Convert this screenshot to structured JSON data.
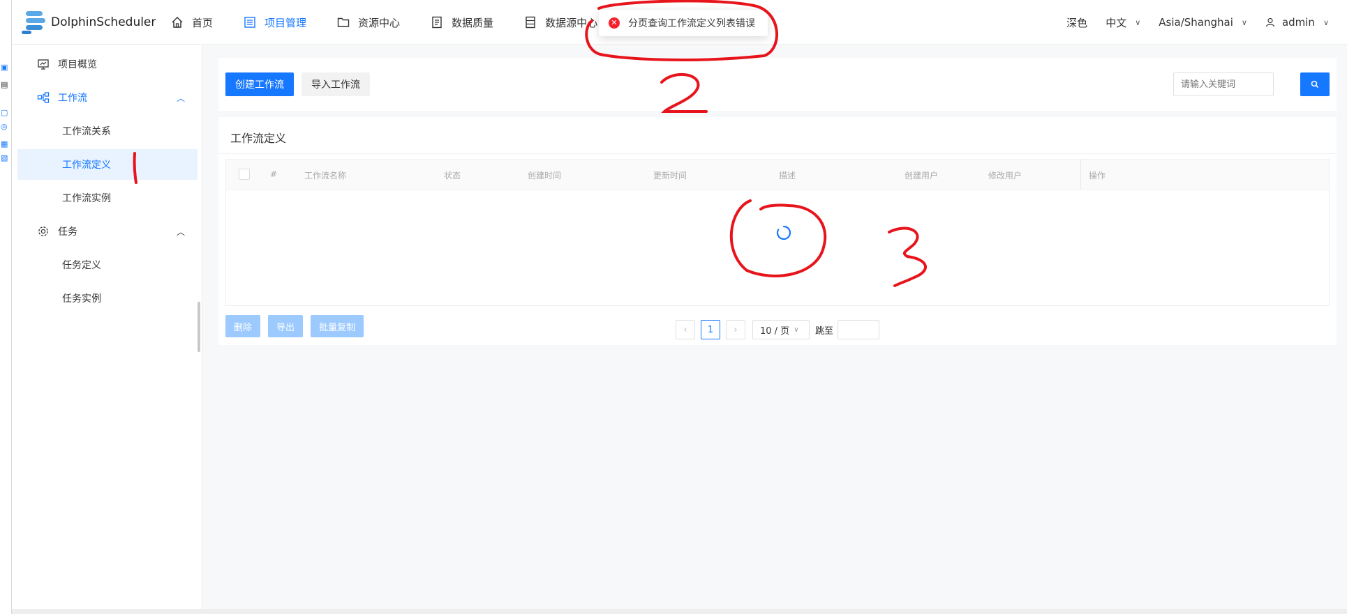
{
  "header": {
    "logo_text": "DolphinScheduler",
    "nav": [
      {
        "label": "首页",
        "icon": "home-icon"
      },
      {
        "label": "项目管理",
        "icon": "project-icon"
      },
      {
        "label": "资源中心",
        "icon": "folder-icon"
      },
      {
        "label": "数据质量",
        "icon": "data-quality-icon"
      },
      {
        "label": "数据源中心",
        "icon": "datasource-icon"
      }
    ],
    "active_nav": "项目管理",
    "theme_label": "深色",
    "language": "中文",
    "timezone": "Asia/Shanghai",
    "user": "admin"
  },
  "toast": {
    "message": "分页查询工作流定义列表错误",
    "type": "error"
  },
  "sidebar": {
    "items": [
      {
        "label": "项目概览",
        "icon": "overview-icon"
      },
      {
        "label": "工作流",
        "icon": "workflow-icon",
        "expanded": true
      },
      {
        "label": "工作流关系"
      },
      {
        "label": "工作流定义",
        "active": true
      },
      {
        "label": "工作流实例"
      },
      {
        "label": "任务",
        "icon": "task-gear-icon",
        "expanded": true
      },
      {
        "label": "任务定义"
      },
      {
        "label": "任务实例"
      }
    ]
  },
  "toolbar": {
    "create_label": "创建工作流",
    "import_label": "导入工作流",
    "search_placeholder": "请输入关键词"
  },
  "list": {
    "title": "工作流定义",
    "columns": [
      "#",
      "工作流名称",
      "状态",
      "创建时间",
      "更新时间",
      "描述",
      "创建用户",
      "修改用户",
      "操作"
    ],
    "loading": true
  },
  "actions": {
    "delete_label": "删除",
    "export_label": "导出",
    "batch_copy_label": "批量复制"
  },
  "pagination": {
    "current_page": "1",
    "page_size": "10 / 页",
    "jump_label": "跳至"
  },
  "annotations": [
    "1",
    "2",
    "3"
  ],
  "colors": {
    "primary": "#1677ff",
    "error": "#f5222d",
    "annotation": "#e8141c"
  }
}
